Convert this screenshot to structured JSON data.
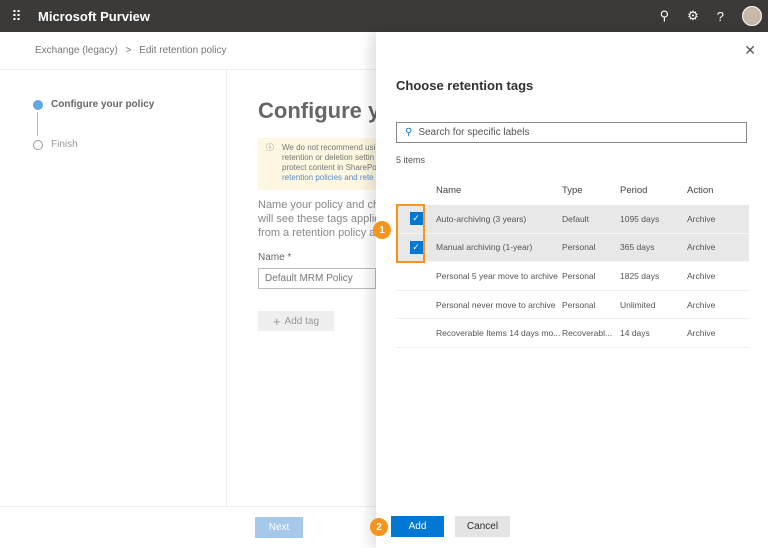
{
  "app": {
    "title": "Microsoft Purview"
  },
  "breadcrumb": {
    "parent": "Exchange (legacy)",
    "sep": ">",
    "current": "Edit retention policy"
  },
  "steps": [
    {
      "label": "Configure your policy"
    },
    {
      "label": "Finish"
    }
  ],
  "main": {
    "title": "Configure y",
    "warning": [
      "We do not recommend usi",
      "retention or deletion settin",
      "protect content in SharePo",
      "retention policies and rete"
    ],
    "description": [
      "Name your policy and ch",
      "will see these tags applie",
      "from a retention policy a"
    ],
    "name_label": "Name *",
    "name_value": "Default MRM Policy",
    "add_tag": "Add tag",
    "next": "Next"
  },
  "panel": {
    "title": "Choose retention tags",
    "search_placeholder": "Search for specific labels",
    "count": "5 items",
    "close": "✕",
    "columns": [
      "Name",
      "Type",
      "Period",
      "Action"
    ],
    "rows": [
      {
        "name": "Auto-archiving (3 years)",
        "type": "Default",
        "period": "1095 days",
        "action": "Archive",
        "selected": true
      },
      {
        "name": "Manual archiving (1-year)",
        "type": "Personal",
        "period": "365 days",
        "action": "Archive",
        "selected": true
      },
      {
        "name": "Personal 5 year move to archive",
        "type": "Personal",
        "period": "1825 days",
        "action": "Archive",
        "selected": false
      },
      {
        "name": "Personal never move to archive",
        "type": "Personal",
        "period": "Unlimited",
        "action": "Archive",
        "selected": false
      },
      {
        "name": "Recoverable Items 14 days mo...",
        "type": "Recoverabl...",
        "period": "14 days",
        "action": "Archive",
        "selected": false
      }
    ],
    "add": "Add",
    "cancel": "Cancel"
  },
  "callouts": [
    "1",
    "2"
  ]
}
